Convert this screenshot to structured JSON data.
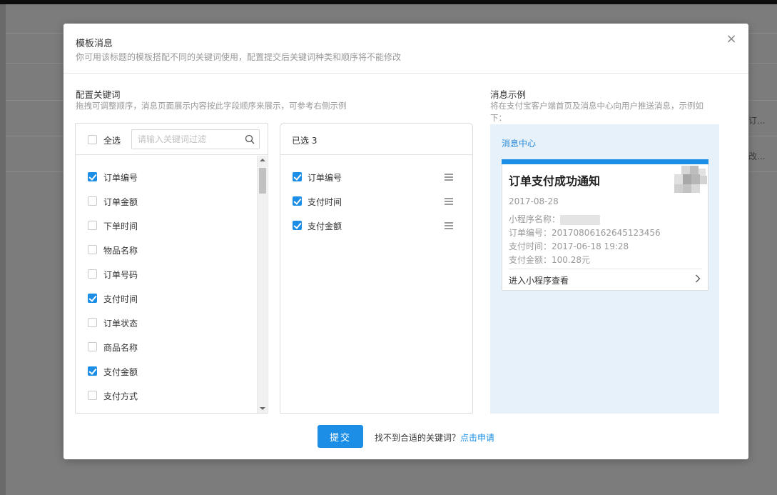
{
  "background": {
    "row1_text": "订...",
    "row2_text": "改..."
  },
  "modal": {
    "title": "模板消息",
    "subtitle": "你可用该标题的模板搭配不同的关键词使用，配置提交后关键词种类和顺序将不能修改"
  },
  "config": {
    "title": "配置关键词",
    "desc": "拖拽可调整顺序，消息页面展示内容按此字段顺序来展示，可参考右侧示例"
  },
  "keyword_list": {
    "select_all_label": "全选",
    "search_placeholder": "请输入关键词过滤",
    "items": [
      {
        "label": "订单编号",
        "checked": true
      },
      {
        "label": "订单金额",
        "checked": false
      },
      {
        "label": "下单时间",
        "checked": false
      },
      {
        "label": "物品名称",
        "checked": false
      },
      {
        "label": "订单号码",
        "checked": false
      },
      {
        "label": "支付时间",
        "checked": true
      },
      {
        "label": "订单状态",
        "checked": false
      },
      {
        "label": "商品名称",
        "checked": false
      },
      {
        "label": "支付金额",
        "checked": true
      },
      {
        "label": "支付方式",
        "checked": false
      }
    ]
  },
  "selected_list": {
    "header": "已选 3",
    "items": [
      {
        "label": "订单编号"
      },
      {
        "label": "支付时间"
      },
      {
        "label": "支付金额"
      }
    ]
  },
  "example": {
    "title": "消息示例",
    "desc_line1": "将在支付宝客户端首页及消息中心向用户推送消息，示例如",
    "desc_line2": "下：",
    "center_label": "消息中心",
    "card": {
      "title": "订单支付成功通知",
      "date": "2017-08-28",
      "app_name_label": "小程序名称：",
      "line_order": "订单编号：20170806162645123456",
      "line_time": "支付时间：2017-06-18 19:28",
      "line_amount": "支付金额：100.28元",
      "link": "进入小程序查看"
    }
  },
  "footer": {
    "submit_label": "提交",
    "hint_text": "找不到合适的关键词？",
    "apply_link": "点击申请"
  },
  "colors": {
    "accent": "#1c8ee6",
    "preview_bg": "#e6f1fa"
  }
}
